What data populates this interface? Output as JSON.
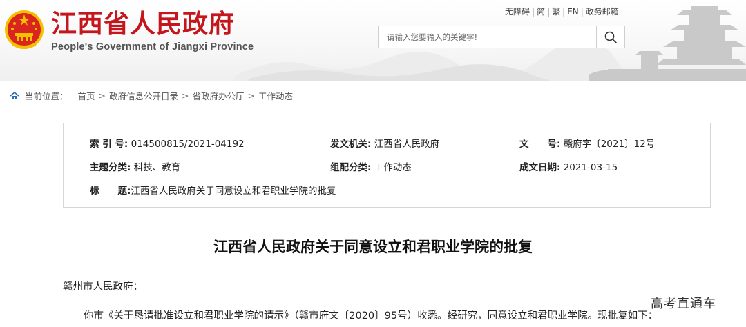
{
  "header": {
    "site_title": "江西省人民政府",
    "site_subtitle": "People's Government of Jiangxi Province",
    "toplinks": [
      "无障碍",
      "简",
      "繁",
      "EN",
      "政务邮箱"
    ],
    "search_placeholder": "请输入您要输入的关键字!"
  },
  "breadcrumb": {
    "label": "当前位置：",
    "items": [
      "首页",
      "政府信息公开目录",
      "省政府办公厅",
      "工作动态"
    ]
  },
  "meta": {
    "index_label": "索 引 号:",
    "index_value": "014500815/2021-04192",
    "issuer_label": "发文机关:",
    "issuer_value": "江西省人民政府",
    "docno_label": "文　　号:",
    "docno_value": "赣府字〔2021〕12号",
    "topic_label": "主题分类:",
    "topic_value": "科技、教育",
    "category_label": "组配分类:",
    "category_value": "工作动态",
    "date_label": "成文日期:",
    "date_value": "2021-03-15",
    "subject_label": "标　　题:",
    "subject_value": "江西省人民政府关于同意设立和君职业学院的批复"
  },
  "article": {
    "title": "江西省人民政府关于同意设立和君职业学院的批复",
    "addressee": "赣州市人民政府：",
    "paragraph1": "你市《关于恳请批准设立和君职业学院的请示》（赣市府文〔2020〕95号）收悉。经研究，同意设立和君职业学院。现批复如下："
  },
  "watermark": "高考直通车",
  "colors": {
    "brand_red": "#c4161c",
    "emblem_gold": "#f5c000"
  }
}
